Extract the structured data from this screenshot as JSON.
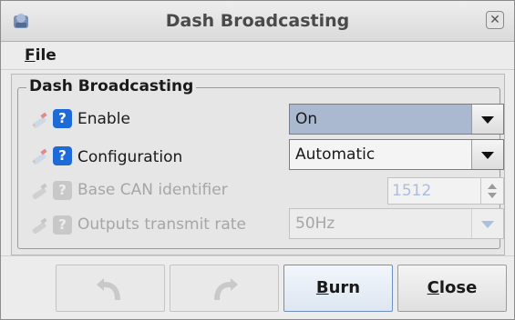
{
  "window": {
    "title": "Dash Broadcasting",
    "close_glyph": "✕"
  },
  "menu": {
    "file_mnemonic": "F",
    "file_rest": "ile"
  },
  "group": {
    "title": "Dash Broadcasting"
  },
  "rows": [
    {
      "label": "Enable",
      "value": "On",
      "enabled": true
    },
    {
      "label": "Configuration",
      "value": "Automatic",
      "enabled": true
    },
    {
      "label": "Base CAN identifier",
      "value": "1512",
      "enabled": false
    },
    {
      "label": "Outputs transmit rate",
      "value": "50Hz",
      "enabled": false
    }
  ],
  "help_glyph": "?",
  "buttons": {
    "undo_icon": "undo-icon",
    "redo_icon": "redo-icon",
    "burn_mnemonic": "B",
    "burn_rest": "urn",
    "close_mnemonic": "C",
    "close_rest": "lose"
  },
  "colors": {
    "help_blue": "#1e6ad6",
    "selected_combo": "#aab9cf",
    "disabled_text": "#a6a6a6"
  }
}
